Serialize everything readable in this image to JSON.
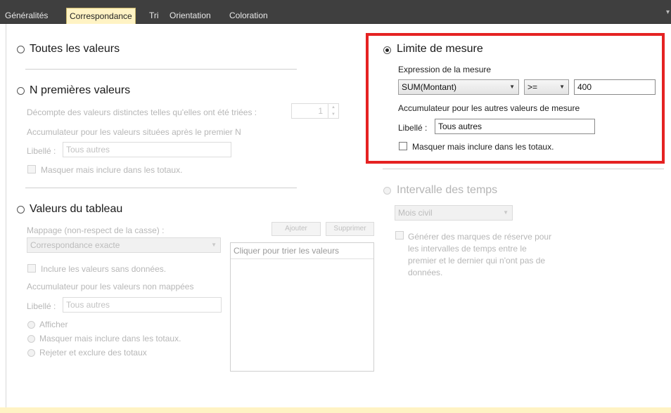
{
  "tabs": [
    {
      "label": "Généralités",
      "active": false
    },
    {
      "label": "Correspondance",
      "active": true
    },
    {
      "label": "Tri",
      "active": false
    },
    {
      "label": "Orientation",
      "active": false
    },
    {
      "label": "Coloration",
      "active": false
    }
  ],
  "toutes_valeurs": {
    "title": "Toutes les valeurs",
    "selected": false
  },
  "n_premieres": {
    "title": "N premières valeurs",
    "selected": false,
    "decompte_label": "Décompte des valeurs distinctes telles qu'elles ont été triées :",
    "decompte_value": "1",
    "accumulateur_label": "Accumulateur pour les valeurs situées après le premier N",
    "libelle_label": "Libellé :",
    "libelle_value": "Tous autres",
    "masquer_label": "Masquer mais inclure dans les totaux."
  },
  "valeurs_tableau": {
    "title": "Valeurs du tableau",
    "selected": false,
    "mappage_label": "Mappage (non-respect de la casse) :",
    "mappage_value": "Correspondance exacte",
    "ajouter_label": "Ajouter",
    "supprimer_label": "Supprimer",
    "list_header": "Cliquer pour trier les valeurs",
    "inclure_label": "Inclure les valeurs sans données.",
    "accumulateur_label": "Accumulateur pour les valeurs non mappées",
    "libelle_label": "Libellé :",
    "libelle_value": "Tous autres",
    "options": [
      "Afficher",
      "Masquer mais inclure dans les totaux.",
      "Rejeter et exclure des totaux"
    ]
  },
  "limite_mesure": {
    "title": "Limite de mesure",
    "selected": true,
    "expression_label": "Expression de la mesure",
    "expression_value": "SUM(Montant)",
    "operator_value": ">=",
    "threshold_value": "400",
    "accumulateur_label": "Accumulateur pour les autres valeurs de mesure",
    "libelle_label": "Libellé :",
    "libelle_value": "Tous autres",
    "masquer_label": "Masquer mais inclure dans les totaux.",
    "masquer_checked": false
  },
  "intervalle_temps": {
    "title": "Intervalle des temps",
    "selected": false,
    "dropdown_value": "Mois civil",
    "generer_label_lines": [
      "Générer des marques de réserve pour",
      "les intervalles de temps entre le",
      "premier et le dernier qui n'ont pas de",
      "données."
    ]
  },
  "colors": {
    "highlight": "#e52222",
    "active_tab": "#fff3c4",
    "tabbar": "#3f3f3f"
  }
}
